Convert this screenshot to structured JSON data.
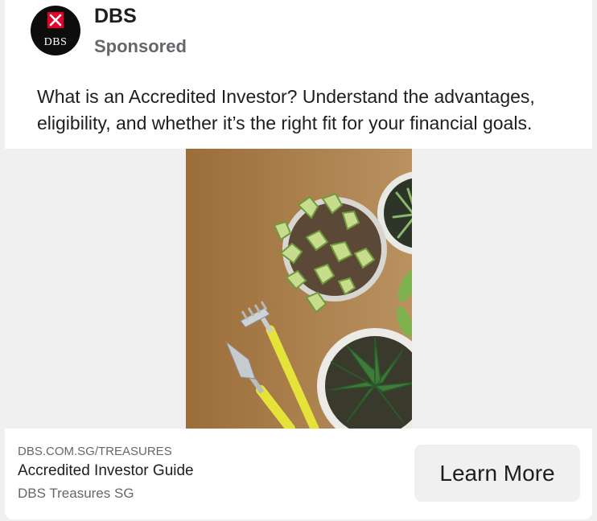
{
  "advertiser": {
    "name": "DBS",
    "logo_text": "DBS",
    "status": "Sponsored"
  },
  "post": {
    "text": "What is an Accredited Investor? Understand the advantages, eligibility, and whether it’s the right fit for your financial goals."
  },
  "media": {
    "description_icon": "plants-and-garden-tools-image"
  },
  "link_card": {
    "domain": "DBS.COM.SG/TREASURES",
    "headline": "Accredited Investor Guide",
    "source": "DBS Treasures SG",
    "cta_label": "Learn More"
  },
  "colors": {
    "brand_red": "#e4002b",
    "text_primary": "#1c1e21",
    "text_secondary": "#65676b",
    "media_bg": "#f0f0f0"
  }
}
